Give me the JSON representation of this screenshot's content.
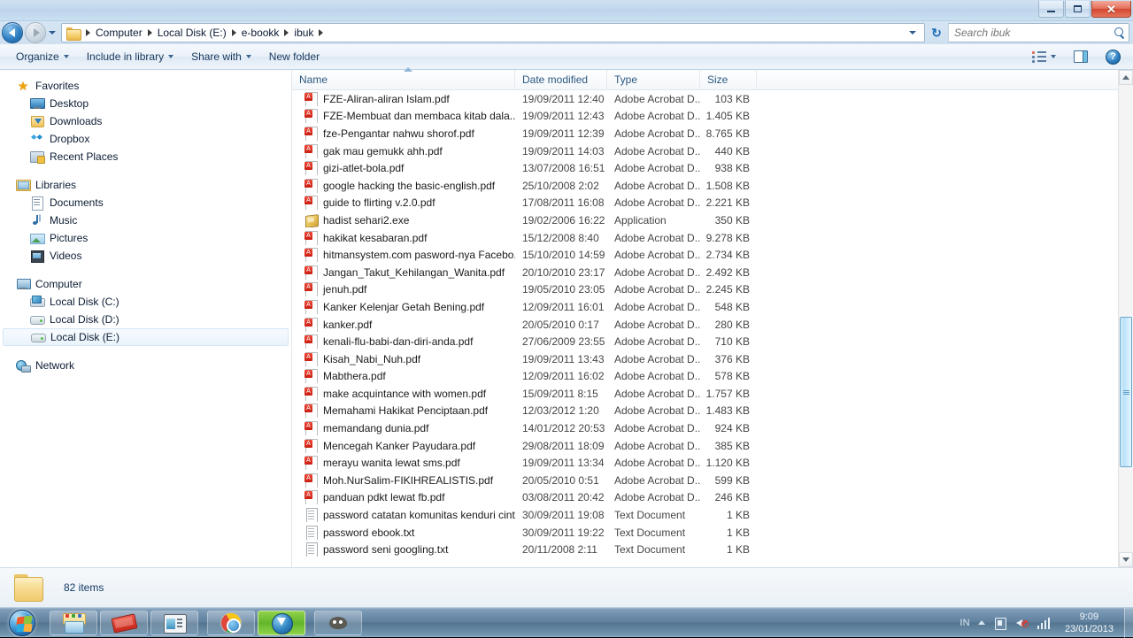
{
  "window": {
    "titlebar_title": "",
    "buttons": {
      "minimize": "Minimize",
      "maximize": "Maximize",
      "close": "Close",
      "close_glyph": "✕"
    }
  },
  "address_bar": {
    "back_tooltip": "Back",
    "forward_tooltip": "Forward",
    "breadcrumbs": [
      "Computer",
      "Local Disk (E:)",
      "e-bookk",
      "ibuk"
    ],
    "refresh_glyph": "↻"
  },
  "search": {
    "placeholder": "Search ibuk",
    "value": ""
  },
  "command_bar": {
    "organize": "Organize",
    "include_in_library": "Include in library",
    "share_with": "Share with",
    "new_folder": "New folder",
    "views_tooltip": "Change your view",
    "preview_pane_tooltip": "Show the preview pane",
    "help_label": "?"
  },
  "sidebar": {
    "groups": [
      {
        "header": {
          "label": "Favorites",
          "icon": "star-icon"
        },
        "items": [
          {
            "label": "Desktop",
            "icon": "desktop-icon"
          },
          {
            "label": "Downloads",
            "icon": "downloads-icon"
          },
          {
            "label": "Dropbox",
            "icon": "dropbox-icon"
          },
          {
            "label": "Recent Places",
            "icon": "recent-places-icon"
          }
        ]
      },
      {
        "header": {
          "label": "Libraries",
          "icon": "libraries-icon"
        },
        "items": [
          {
            "label": "Documents",
            "icon": "documents-icon"
          },
          {
            "label": "Music",
            "icon": "music-icon"
          },
          {
            "label": "Pictures",
            "icon": "pictures-icon"
          },
          {
            "label": "Videos",
            "icon": "videos-icon"
          }
        ]
      },
      {
        "header": {
          "label": "Computer",
          "icon": "computer-icon"
        },
        "items": [
          {
            "label": "Local Disk (C:)",
            "icon": "system-drive-icon",
            "selected": false
          },
          {
            "label": "Local Disk (D:)",
            "icon": "drive-icon",
            "selected": false
          },
          {
            "label": "Local Disk (E:)",
            "icon": "drive-icon",
            "selected": true
          }
        ]
      },
      {
        "header": {
          "label": "Network",
          "icon": "network-icon"
        },
        "items": []
      }
    ]
  },
  "file_list": {
    "columns": [
      {
        "key": "name",
        "label": "Name",
        "sorted": "ascending"
      },
      {
        "key": "date",
        "label": "Date modified"
      },
      {
        "key": "type",
        "label": "Type"
      },
      {
        "key": "size",
        "label": "Size"
      }
    ],
    "rows": [
      {
        "name": "FZE-Aliran-aliran Islam.pdf",
        "date": "19/09/2011 12:40",
        "type": "Adobe Acrobat D...",
        "size": "103 KB",
        "icon": "pdf-icon"
      },
      {
        "name": "FZE-Membuat dan membaca kitab dala...",
        "date": "19/09/2011 12:43",
        "type": "Adobe Acrobat D...",
        "size": "1.405 KB",
        "icon": "pdf-icon"
      },
      {
        "name": "fze-Pengantar nahwu shorof.pdf",
        "date": "19/09/2011 12:39",
        "type": "Adobe Acrobat D...",
        "size": "8.765 KB",
        "icon": "pdf-icon"
      },
      {
        "name": "gak mau gemukk ahh.pdf",
        "date": "19/09/2011 14:03",
        "type": "Adobe Acrobat D...",
        "size": "440 KB",
        "icon": "pdf-icon"
      },
      {
        "name": "gizi-atlet-bola.pdf",
        "date": "13/07/2008 16:51",
        "type": "Adobe Acrobat D...",
        "size": "938 KB",
        "icon": "pdf-icon"
      },
      {
        "name": "google hacking the basic-english.pdf",
        "date": "25/10/2008 2:02",
        "type": "Adobe Acrobat D...",
        "size": "1.508 KB",
        "icon": "pdf-icon"
      },
      {
        "name": "guide to flirting v.2.0.pdf",
        "date": "17/08/2011 16:08",
        "type": "Adobe Acrobat D...",
        "size": "2.221 KB",
        "icon": "pdf-icon"
      },
      {
        "name": "hadist sehari2.exe",
        "date": "19/02/2006 16:22",
        "type": "Application",
        "size": "350 KB",
        "icon": "application-icon"
      },
      {
        "name": "hakikat kesabaran.pdf",
        "date": "15/12/2008 8:40",
        "type": "Adobe Acrobat D...",
        "size": "9.278 KB",
        "icon": "pdf-icon"
      },
      {
        "name": "hitmansystem.com pasword-nya Facebo...",
        "date": "15/10/2010 14:59",
        "type": "Adobe Acrobat D...",
        "size": "2.734 KB",
        "icon": "pdf-icon"
      },
      {
        "name": "Jangan_Takut_Kehilangan_Wanita.pdf",
        "date": "20/10/2010 23:17",
        "type": "Adobe Acrobat D...",
        "size": "2.492 KB",
        "icon": "pdf-icon"
      },
      {
        "name": "jenuh.pdf",
        "date": "19/05/2010 23:05",
        "type": "Adobe Acrobat D...",
        "size": "2.245 KB",
        "icon": "pdf-icon"
      },
      {
        "name": "Kanker Kelenjar Getah Bening.pdf",
        "date": "12/09/2011 16:01",
        "type": "Adobe Acrobat D...",
        "size": "548 KB",
        "icon": "pdf-icon"
      },
      {
        "name": "kanker.pdf",
        "date": "20/05/2010 0:17",
        "type": "Adobe Acrobat D...",
        "size": "280 KB",
        "icon": "pdf-icon"
      },
      {
        "name": "kenali-flu-babi-dan-diri-anda.pdf",
        "date": "27/06/2009 23:55",
        "type": "Adobe Acrobat D...",
        "size": "710 KB",
        "icon": "pdf-icon"
      },
      {
        "name": "Kisah_Nabi_Nuh.pdf",
        "date": "19/09/2011 13:43",
        "type": "Adobe Acrobat D...",
        "size": "376 KB",
        "icon": "pdf-icon"
      },
      {
        "name": "Mabthera.pdf",
        "date": "12/09/2011 16:02",
        "type": "Adobe Acrobat D...",
        "size": "578 KB",
        "icon": "pdf-icon"
      },
      {
        "name": "make acquintance with women.pdf",
        "date": "15/09/2011 8:15",
        "type": "Adobe Acrobat D...",
        "size": "1.757 KB",
        "icon": "pdf-icon"
      },
      {
        "name": "Memahami Hakikat Penciptaan.pdf",
        "date": "12/03/2012 1:20",
        "type": "Adobe Acrobat D...",
        "size": "1.483 KB",
        "icon": "pdf-icon"
      },
      {
        "name": "memandang dunia.pdf",
        "date": "14/01/2012 20:53",
        "type": "Adobe Acrobat D...",
        "size": "924 KB",
        "icon": "pdf-icon"
      },
      {
        "name": "Mencegah Kanker Payudara.pdf",
        "date": "29/08/2011 18:09",
        "type": "Adobe Acrobat D...",
        "size": "385 KB",
        "icon": "pdf-icon"
      },
      {
        "name": "merayu wanita lewat sms.pdf",
        "date": "19/09/2011 13:34",
        "type": "Adobe Acrobat D...",
        "size": "1.120 KB",
        "icon": "pdf-icon"
      },
      {
        "name": "Moh.NurSalim-FIKIHREALISTIS.pdf",
        "date": "20/05/2010 0:51",
        "type": "Adobe Acrobat D...",
        "size": "599 KB",
        "icon": "pdf-icon"
      },
      {
        "name": "panduan pdkt lewat fb.pdf",
        "date": "03/08/2011 20:42",
        "type": "Adobe Acrobat D...",
        "size": "246 KB",
        "icon": "pdf-icon"
      },
      {
        "name": "password catatan komunitas kenduri cint...",
        "date": "30/09/2011 19:08",
        "type": "Text Document",
        "size": "1 KB",
        "icon": "text-icon"
      },
      {
        "name": "password ebook.txt",
        "date": "30/09/2011 19:22",
        "type": "Text Document",
        "size": "1 KB",
        "icon": "text-icon"
      },
      {
        "name": "password seni googling.txt",
        "date": "20/11/2008 2:11",
        "type": "Text Document",
        "size": "1 KB",
        "icon": "text-icon"
      }
    ]
  },
  "status_bar": {
    "item_count": "82 items",
    "icon": "folder-icon"
  },
  "taskbar": {
    "start_tooltip": "Start",
    "items": [
      {
        "name": "windows-explorer",
        "label": "Windows Explorer"
      },
      {
        "name": "ebook-reader",
        "label": "Book Reader"
      },
      {
        "name": "media-player",
        "label": "Media Player"
      },
      {
        "name": "google-chrome",
        "label": "Google Chrome"
      },
      {
        "name": "internet-download-manager",
        "label": "Internet Download Manager"
      },
      {
        "name": "gimp",
        "label": "GIMP"
      }
    ],
    "tray": {
      "language": "IN",
      "show_hidden_tooltip": "Show hidden icons",
      "action_center_tooltip": "Action Center",
      "volume_tooltip": "Volume muted",
      "network_tooltip": "Network",
      "time": "9:09",
      "date": "23/01/2013"
    }
  },
  "colors": {
    "accent": "#2a6ba8",
    "selection": "#eaf3fb",
    "pdf_red": "#c81d10",
    "taskbar": "#5e7f9e",
    "idm_highlight": "#63b62c"
  }
}
